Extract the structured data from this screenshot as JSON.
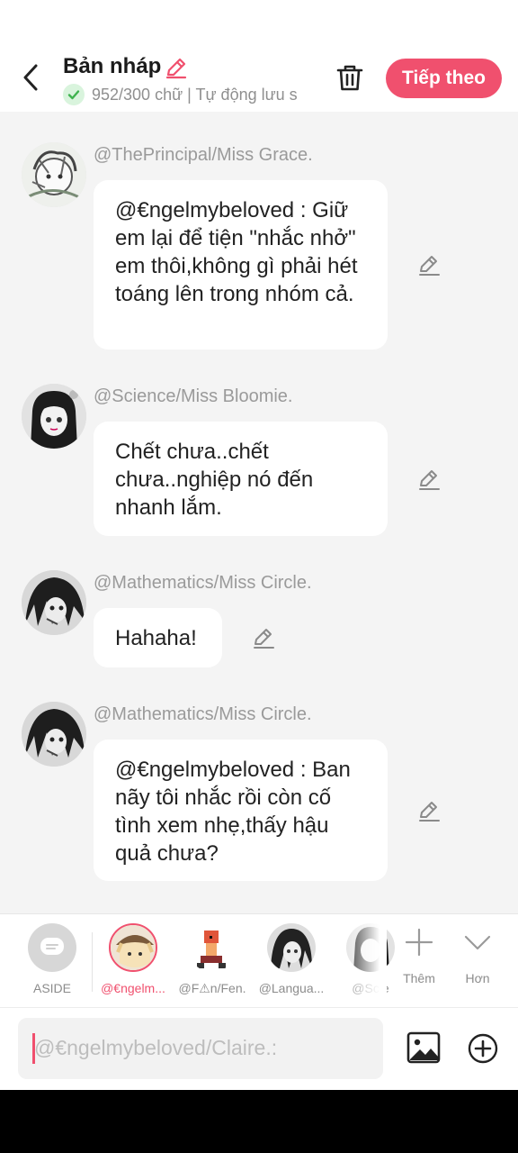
{
  "header": {
    "title": "Bản nháp",
    "word_count": "952/300 chữ",
    "autosave": "| Tự động lưu s",
    "next_button": "Tiếp theo",
    "accent": "#f0506e"
  },
  "messages": [
    {
      "username": "@ThePrincipal/Miss Grace.",
      "text": "@€ngelmybeloved : Giữ em lại để tiện \"nhắc nhở\" em thôi,không gì phải hét toáng lên trong nhóm cả."
    },
    {
      "username": "@Science/Miss Bloomie.",
      "text": "Chết chưa..chết chưa..nghiệp nó đến nhanh lắm."
    },
    {
      "username": "@Mathematics/Miss Circle.",
      "text": "Hahaha!"
    },
    {
      "username": "@Mathematics/Miss Circle.",
      "text": "@€ngelmybeloved : Ban nãy tôi nhắc rồi còn cố tình xem nhẹ,thấy hậu quả chưa?"
    }
  ],
  "characters": [
    {
      "label": "ASIDE",
      "icon": "chat-bubble-icon"
    },
    {
      "label": "@€ngelm...",
      "selected": true
    },
    {
      "label": "@F⚠n/Fen."
    },
    {
      "label": "@Langua..."
    },
    {
      "label": "@Scie"
    }
  ],
  "actions": {
    "add_label": "Thêm",
    "more_label": "Hơn"
  },
  "input": {
    "placeholder": "@€ngelmybeloved/Claire.:"
  }
}
